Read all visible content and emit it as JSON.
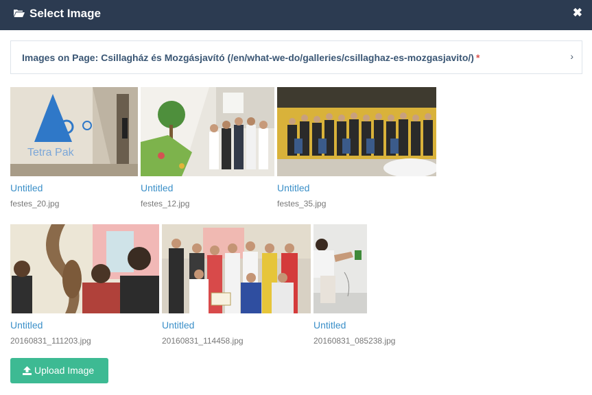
{
  "dialog": {
    "title": "Select Image",
    "close_label": "✖",
    "close_icon": "close-icon",
    "title_icon": "folder-open-icon"
  },
  "panel": {
    "heading": "Images on Page: Csillagház és Mozgásjavító (/en/what-we-do/galleries/csillaghaz-es-mozgasjavito/)",
    "required_mark": "*",
    "chevron": "›"
  },
  "images": [
    {
      "title": "Untitled",
      "filename": "festes_20.jpg"
    },
    {
      "title": "Untitled",
      "filename": "festes_12.jpg"
    },
    {
      "title": "Untitled",
      "filename": "festes_35.jpg"
    },
    {
      "title": "Untitled",
      "filename": "20160831_111203.jpg"
    },
    {
      "title": "Untitled",
      "filename": "20160831_114458.jpg"
    },
    {
      "title": "Untitled",
      "filename": "20160831_085238.jpg"
    }
  ],
  "upload": {
    "label": "Upload Image",
    "icon": "upload-icon"
  },
  "colors": {
    "header_bg": "#2c3b51",
    "link": "#3a8fc8",
    "button": "#3dba93",
    "required": "#d9534f"
  }
}
